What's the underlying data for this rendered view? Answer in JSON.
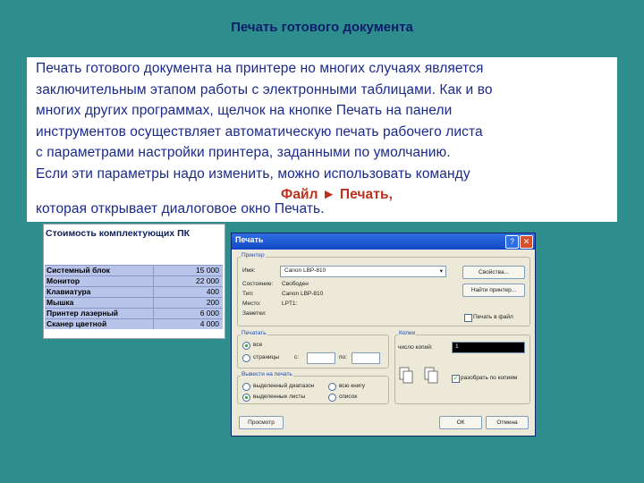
{
  "slide": {
    "title": "Печать готового документа",
    "lines": [
      "Печать готового документа на принтере но многих случаях является",
      "заключительным этапом работы с электронными таблицами. Как и во",
      "многих других программах, щелчок на кнопке Печать на панели",
      "инструментов осуществляет автоматическую печать рабочего листа",
      "с параметрами настройки принтера, заданными по умолчанию.",
      "Если эти параметры надо изменить, можно использовать команду"
    ],
    "command": "Файл ► Печать,",
    "last_line": "которая открывает диалоговое окно Печать."
  },
  "sheet": {
    "title": "Стоимость комплектующих ПК",
    "rows": [
      {
        "name": "Системный блок",
        "value": "15 000"
      },
      {
        "name": "Монитор",
        "value": "22 000"
      },
      {
        "name": "Клавиатура",
        "value": "400"
      },
      {
        "name": "Мышка",
        "value": "200"
      },
      {
        "name": "Принтер лазерный",
        "value": "6 000"
      },
      {
        "name": "Сканер цветной",
        "value": "4 000"
      }
    ]
  },
  "dialog": {
    "title": "Печать",
    "help_btn": "?",
    "close_btn": "✕",
    "printer_group": "Принтер",
    "name_label": "Имя:",
    "name_value": "Canon LBP-810",
    "status_label": "Состояние:",
    "status_value": "Свободен",
    "type_label": "Тип:",
    "type_value": "Canon LBP-810",
    "place_label": "Место:",
    "place_value": "LPT1:",
    "note_label": "Заметки:",
    "props_btn": "Свойства...",
    "find_btn": "Найти принтер...",
    "print_to_file": "Печать в файл",
    "range_group": "Печатать",
    "all_label": "все",
    "pages_label": "страницы",
    "from_label": "с:",
    "to_label": "по:",
    "output_group": "Вывести на печать",
    "selection_label": "выделенный диапазон",
    "whole_book_label": "всю книгу",
    "selected_sheets_label": "выделенные листы",
    "list_label": "список",
    "copies_group": "Копии",
    "copies_label": "число копий:",
    "copies_value": "1",
    "collate_label": "разобрать по копиям",
    "preview_btn": "Просмотр",
    "ok_btn": "ОК",
    "cancel_btn": "Отмена"
  }
}
